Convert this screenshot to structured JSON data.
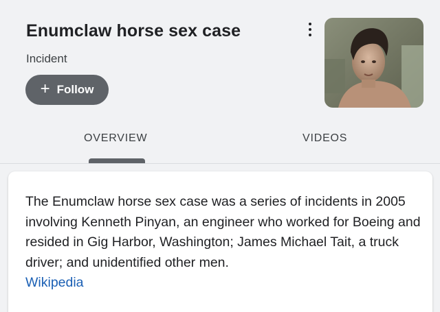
{
  "entity": {
    "title": "Enumclaw horse sex case",
    "type": "Incident",
    "follow_label": "Follow",
    "more_icon": "vertical-ellipsis-icon"
  },
  "tabs": [
    {
      "label": "OVERVIEW",
      "selected": true
    },
    {
      "label": "VIDEOS",
      "selected": false
    }
  ],
  "card": {
    "description": "The Enumclaw horse sex case was a series of incidents in 2005 involving Kenneth Pinyan, an engineer who worked for Boeing and resided in Gig Harbor, Washington; James Michael Tait, a truck driver; and unidentified other men.",
    "source_link": "Wikipedia"
  },
  "colors": {
    "background": "#f1f2f4",
    "button": "#5f6368",
    "link": "#1a5fb4",
    "card": "#ffffff"
  }
}
